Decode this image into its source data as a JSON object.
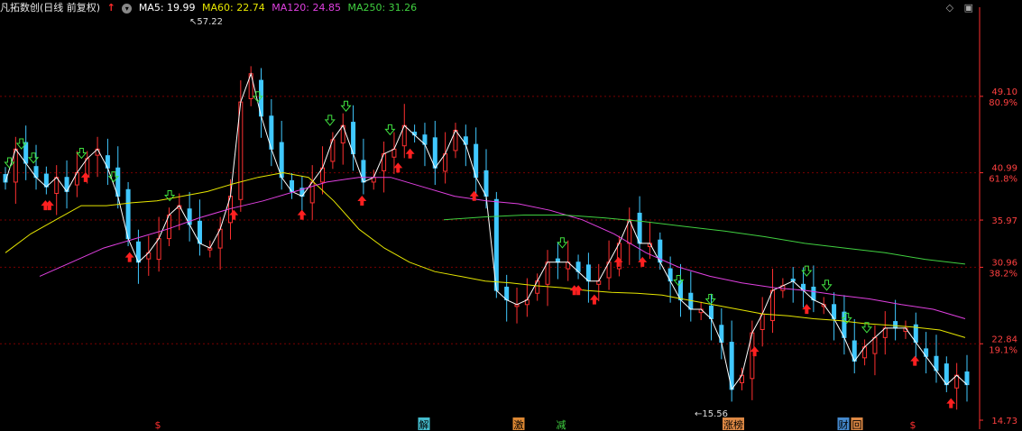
{
  "header": {
    "stock": "凡拓数创(日线 前复权)",
    "ma": [
      {
        "label": "MA5: 19.99",
        "color": "#ffffff"
      },
      {
        "label": "MA60: 22.74",
        "color": "#e6e600"
      },
      {
        "label": "MA120: 24.85",
        "color": "#e040e0"
      },
      {
        "label": "MA250: 31.26",
        "color": "#40d040"
      }
    ]
  },
  "chart_data": {
    "type": "candlestick",
    "y_ticks": [
      {
        "value": 49.1,
        "price": "49.10",
        "pct": "80.9%"
      },
      {
        "value": 40.99,
        "price": "40.99",
        "pct": "61.8%"
      },
      {
        "value": 35.97,
        "price": "35.97",
        "pct": ""
      },
      {
        "value": 30.96,
        "price": "30.96",
        "pct": "38.2%"
      },
      {
        "value": 22.84,
        "price": "22.84",
        "pct": "19.1%"
      },
      {
        "value": 14.73,
        "price": "14.73",
        "pct": ""
      }
    ],
    "ylim": [
      14.73,
      57.22
    ],
    "max_label": "57.22",
    "min_label": "15.56",
    "ma5_close": [
      40,
      43.5,
      42,
      40.5,
      39.5,
      40.5,
      39.0,
      41,
      42.5,
      43.5,
      41.5,
      38.5,
      34,
      31.5,
      32.5,
      34,
      36.5,
      37.5,
      35.5,
      33.5,
      33,
      35,
      38.5,
      48.5,
      51.5,
      47,
      43.5,
      40.5,
      39.0,
      38.5,
      40,
      41.5,
      44.5,
      46,
      43,
      40,
      40.5,
      43,
      43.5,
      46,
      45,
      44,
      41.5,
      43,
      45.5,
      44,
      40.5,
      38.5,
      28.5,
      27.5,
      27,
      27.5,
      29.5,
      31.5,
      31.5,
      31.5,
      30.5,
      29.5,
      29.5,
      31.5,
      33.5,
      36,
      33.5,
      33.5,
      31.5,
      29.5,
      27.5,
      26.5,
      26.5,
      25.5,
      23,
      18,
      19.5,
      24,
      26,
      28.5,
      29,
      29.5,
      28.5,
      27.5,
      27,
      25.5,
      23.5,
      21,
      22.5,
      23.5,
      24.5,
      24.5,
      24.5,
      23,
      21.5,
      20,
      18.5,
      19.5,
      18.5
    ],
    "ma60": [
      32.5,
      34.5,
      36,
      37.5,
      37.5,
      37.8,
      38,
      38.5,
      39,
      39.8,
      40.5,
      41,
      40.5,
      38,
      35,
      33,
      31.5,
      30.5,
      30,
      29.5,
      29.3,
      29,
      28.8,
      28.5,
      28.3,
      28.2,
      28,
      27.5,
      27,
      26.5,
      26,
      25.8,
      25.5,
      25.3,
      25,
      24.8,
      24.6,
      24.3,
      23.5
    ],
    "ma120": [
      30,
      31.5,
      33,
      34,
      35,
      36.2,
      37.2,
      38,
      39,
      40,
      40.5,
      40.5,
      39.5,
      38.5,
      38,
      37.7,
      37,
      36,
      34.5,
      32.5,
      31,
      30,
      29.3,
      28.8,
      28.5,
      28,
      27.6,
      27,
      26.5,
      25.5
    ],
    "ma250": [
      36,
      36.3,
      36.5,
      36.5,
      36.2,
      35.8,
      35.3,
      34.8,
      34.2,
      33.5,
      33,
      32.5,
      31.8,
      31.3
    ],
    "buy_signals": [
      10,
      11,
      20,
      31,
      57,
      74,
      89,
      98,
      101,
      117,
      142,
      143,
      147,
      153,
      159,
      187,
      200,
      227,
      236
    ],
    "sell_signals": [
      1,
      4,
      7,
      19,
      27,
      41,
      63,
      81,
      85,
      96,
      139,
      168,
      176,
      200,
      205,
      210,
      215
    ]
  },
  "event_markers": [
    {
      "label": "$",
      "color": "#ff3030",
      "bg": ""
    },
    {
      "label": "解",
      "color": "#000000",
      "bg": "#44bbcc"
    },
    {
      "label": "激",
      "color": "#000000",
      "bg": "#dd8833"
    },
    {
      "label": "减",
      "color": "#40d040",
      "bg": ""
    },
    {
      "label": "涨榜",
      "color": "#000000",
      "bg": "#dd8844"
    },
    {
      "label": "财",
      "color": "#000000",
      "bg": "#4488cc"
    },
    {
      "label": "回",
      "color": "#000000",
      "bg": "#dd8844"
    },
    {
      "label": "$",
      "color": "#ff3030",
      "bg": ""
    }
  ],
  "colors": {
    "up": "#ff3030",
    "down": "#40c8ff",
    "grid": "#7a0000",
    "axis": "#ff3030"
  }
}
